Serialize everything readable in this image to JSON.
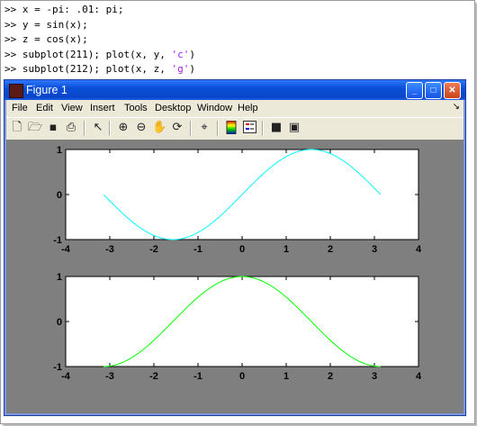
{
  "console": {
    "lines": [
      {
        "prompt": ">> ",
        "code": "x = -pi: .01: pi;"
      },
      {
        "prompt": ">> ",
        "code": "y = sin(x);"
      },
      {
        "prompt": ">> ",
        "code": "z = cos(x);"
      },
      {
        "prompt": ">> ",
        "code": "subplot(211); plot(x, y, ",
        "str": "'c'",
        "tail": ")"
      },
      {
        "prompt": ">> ",
        "code": "subplot(212); plot(x, z, ",
        "str": "'g'",
        "tail": ")"
      }
    ]
  },
  "window": {
    "title": "Figure 1",
    "minimize_glyph": "_",
    "maximize_glyph": "□",
    "close_glyph": "✕"
  },
  "menu": {
    "items": [
      "File",
      "Edit",
      "View",
      "Insert",
      "Tools",
      "Desktop",
      "Window",
      "Help"
    ],
    "dock_glyph": "↘"
  },
  "toolbar": {
    "icons": [
      "new-file-icon",
      "open-folder-icon",
      "save-icon",
      "print-icon",
      "pointer-icon",
      "zoom-in-icon",
      "zoom-out-icon",
      "pan-hand-icon",
      "rotate-3d-icon",
      "data-cursor-icon",
      "colorbar-icon",
      "legend-icon",
      "hide-plot-tools-icon",
      "show-plot-tools-icon"
    ]
  },
  "chart_data": [
    {
      "type": "line",
      "function": "sin",
      "x_range": [
        -3.14159,
        3.14159
      ],
      "xlim": [
        -4,
        4
      ],
      "ylim": [
        -1,
        1
      ],
      "xticks": [
        "-4",
        "-3",
        "-2",
        "-1",
        "0",
        "1",
        "2",
        "3",
        "4"
      ],
      "yticks": [
        "1",
        "0",
        "-1"
      ],
      "series": [
        {
          "color": "#00ffff",
          "x": [
            -3.14,
            -2.5,
            -2.0,
            -1.57,
            -1.0,
            -0.5,
            0.0,
            0.5,
            1.0,
            1.57,
            2.0,
            2.5,
            3.14
          ],
          "values": [
            0.0,
            -0.6,
            -0.91,
            -1.0,
            -0.84,
            -0.48,
            0.0,
            0.48,
            0.84,
            1.0,
            0.91,
            0.6,
            0.0
          ]
        }
      ]
    },
    {
      "type": "line",
      "function": "cos",
      "x_range": [
        -3.14159,
        3.14159
      ],
      "xlim": [
        -4,
        4
      ],
      "ylim": [
        -1,
        1
      ],
      "xticks": [
        "-4",
        "-3",
        "-2",
        "-1",
        "0",
        "1",
        "2",
        "3",
        "4"
      ],
      "yticks": [
        "1",
        "0",
        "-1"
      ],
      "series": [
        {
          "color": "#00ff00",
          "x": [
            -3.14,
            -2.5,
            -2.0,
            -1.57,
            -1.0,
            -0.5,
            0.0,
            0.5,
            1.0,
            1.57,
            2.0,
            2.5,
            3.14
          ],
          "values": [
            -1.0,
            -0.8,
            -0.42,
            0.0,
            0.54,
            0.88,
            1.0,
            0.88,
            0.54,
            0.0,
            -0.42,
            -0.8,
            -1.0
          ]
        }
      ]
    }
  ]
}
